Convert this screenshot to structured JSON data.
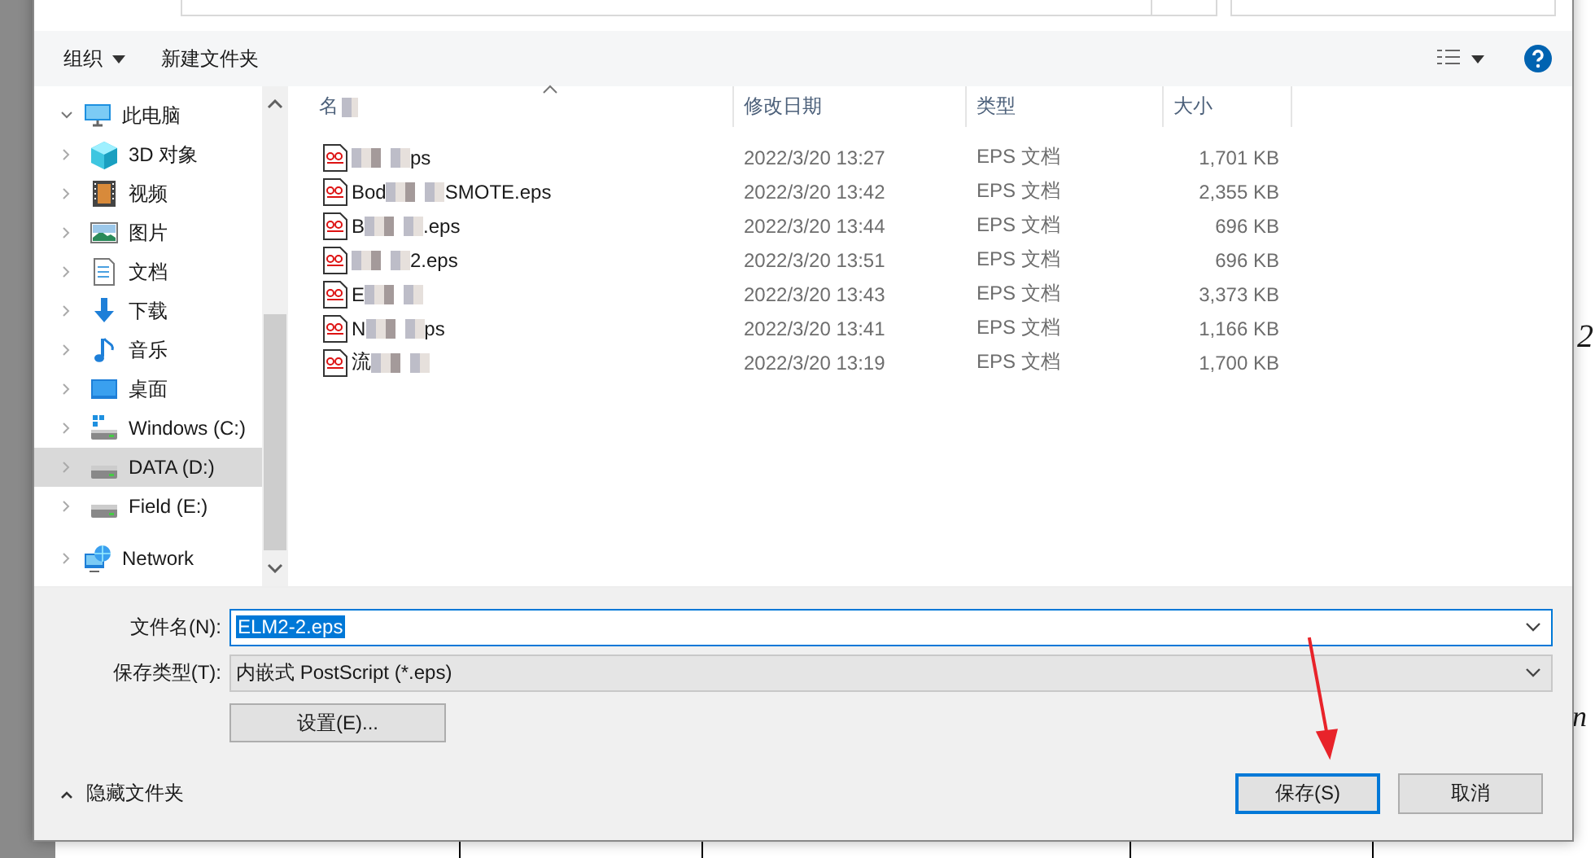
{
  "toolbar": {
    "organize": "组织",
    "new_folder": "新建文件夹"
  },
  "nav": [
    {
      "label": "此电脑",
      "expanded": true,
      "selected": false,
      "children": [
        {
          "label": "3D 对象",
          "selected": false
        },
        {
          "label": "视频",
          "selected": false
        },
        {
          "label": "图片",
          "selected": false
        },
        {
          "label": "文档",
          "selected": false
        },
        {
          "label": "下载",
          "selected": false
        },
        {
          "label": "音乐",
          "selected": false
        },
        {
          "label": "桌面",
          "selected": false
        },
        {
          "label": "Windows (C:)",
          "selected": false
        },
        {
          "label": "DATA (D:)",
          "selected": true
        },
        {
          "label": "Field (E:)",
          "selected": false
        }
      ]
    },
    {
      "label": "Network",
      "expanded": false,
      "selected": false
    }
  ],
  "columns": [
    {
      "label": "名"
    },
    {
      "label": "修改日期"
    },
    {
      "label": "类型"
    },
    {
      "label": "大小"
    }
  ],
  "files": [
    {
      "suffix": "ps",
      "date": "2022/3/20 13:27",
      "type": "EPS 文档",
      "size": "1,701 KB"
    },
    {
      "prefix": "Bod",
      "suffix": "SMOTE.eps",
      "date": "2022/3/20 13:42",
      "type": "EPS 文档",
      "size": "2,355 KB"
    },
    {
      "prefix": "B",
      "suffix": ".eps",
      "date": "2022/3/20 13:44",
      "type": "EPS 文档",
      "size": "696 KB"
    },
    {
      "suffix": "2.eps",
      "date": "2022/3/20 13:51",
      "type": "EPS 文档",
      "size": "696 KB"
    },
    {
      "prefix": "E",
      "date": "2022/3/20 13:43",
      "type": "EPS 文档",
      "size": "3,373 KB"
    },
    {
      "prefix": "N",
      "suffix": "ps",
      "date": "2022/3/20 13:41",
      "type": "EPS 文档",
      "size": "1,166 KB"
    },
    {
      "prefix": "流",
      "date": "2022/3/20 13:19",
      "type": "EPS 文档",
      "size": "1,700 KB"
    }
  ],
  "filename": {
    "label": "文件名(N):",
    "value": "ELM2-2.eps"
  },
  "filetype": {
    "label": "保存类型(T):",
    "value": "内嵌式 PostScript (*.eps)"
  },
  "settings_button": "设置(E)...",
  "hide_folders": "隐藏文件夹",
  "buttons": [
    {
      "label": "保存(S)",
      "kind": "primary"
    },
    {
      "label": "取消",
      "kind": "normal"
    }
  ],
  "background": {
    "fragments": [
      "2",
      "n"
    ]
  }
}
